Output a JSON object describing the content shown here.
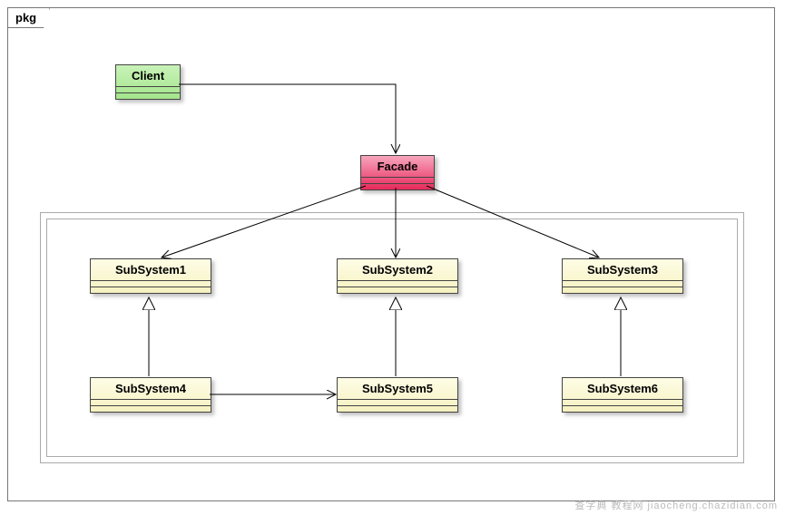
{
  "package": {
    "label": "pkg"
  },
  "classes": {
    "client": "Client",
    "facade": "Facade",
    "s1": "SubSystem1",
    "s2": "SubSystem2",
    "s3": "SubSystem3",
    "s4": "SubSystem4",
    "s5": "SubSystem5",
    "s6": "SubSystem6"
  },
  "relations": [
    {
      "from": "Client",
      "to": "Facade",
      "type": "association"
    },
    {
      "from": "Facade",
      "to": "SubSystem1",
      "type": "association"
    },
    {
      "from": "Facade",
      "to": "SubSystem2",
      "type": "association"
    },
    {
      "from": "Facade",
      "to": "SubSystem3",
      "type": "association"
    },
    {
      "from": "SubSystem4",
      "to": "SubSystem1",
      "type": "generalization"
    },
    {
      "from": "SubSystem5",
      "to": "SubSystem2",
      "type": "generalization"
    },
    {
      "from": "SubSystem6",
      "to": "SubSystem3",
      "type": "generalization"
    },
    {
      "from": "SubSystem4",
      "to": "SubSystem5",
      "type": "association"
    }
  ],
  "watermark": "查字典  教程网  jiaocheng.chazidian.com"
}
